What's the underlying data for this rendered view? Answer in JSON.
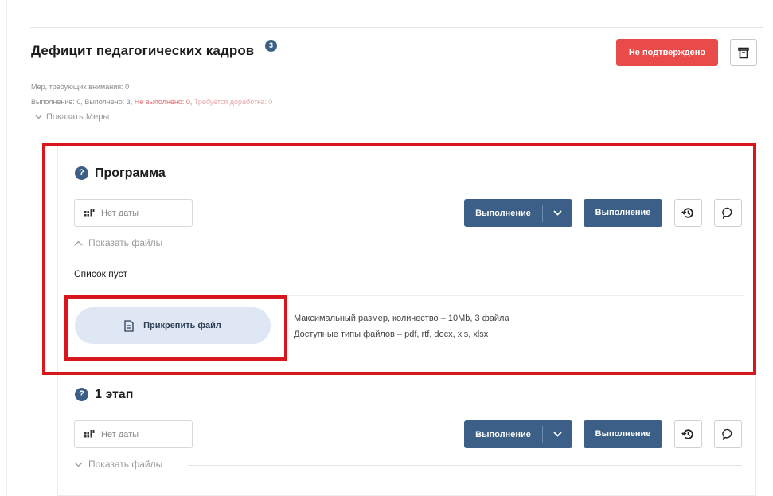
{
  "header": {
    "title": "Дефицит педагогических кадров",
    "badge": "3",
    "status_button": "Не подтверждено"
  },
  "meta": {
    "measures_attention": "Мер, требующих внимания: 0",
    "progress_prefix": "Выполнение: 0, Выполнено: 3, ",
    "not_done": "Не выполнено: 0, ",
    "needs_rework": "Требуется доработка: 0",
    "show_measures": "Показать Меры"
  },
  "sections": [
    {
      "title": "Программа",
      "date": "Нет даты",
      "split_button": "Выполнение",
      "plain_button": "Выполнение",
      "files_toggle": "Показать файлы",
      "empty_text": "Список пуст",
      "attach_button": "Прикрепить файл",
      "limits_line1_prefix": "Максимальный размер, количество – ",
      "limits_line1_value": "10Mb, 3 файла",
      "limits_line2_prefix": "Доступные типы файлов – ",
      "limits_line2_value": "pdf, rtf, docx, xls, xlsx"
    },
    {
      "title": "1 этап",
      "date": "Нет даты",
      "split_button": "Выполнение",
      "plain_button": "Выполнение",
      "files_toggle": "Показать файлы"
    }
  ],
  "colors": {
    "accent": "#3b5f86",
    "danger": "#e94b4b",
    "highlight": "#d9161c"
  }
}
